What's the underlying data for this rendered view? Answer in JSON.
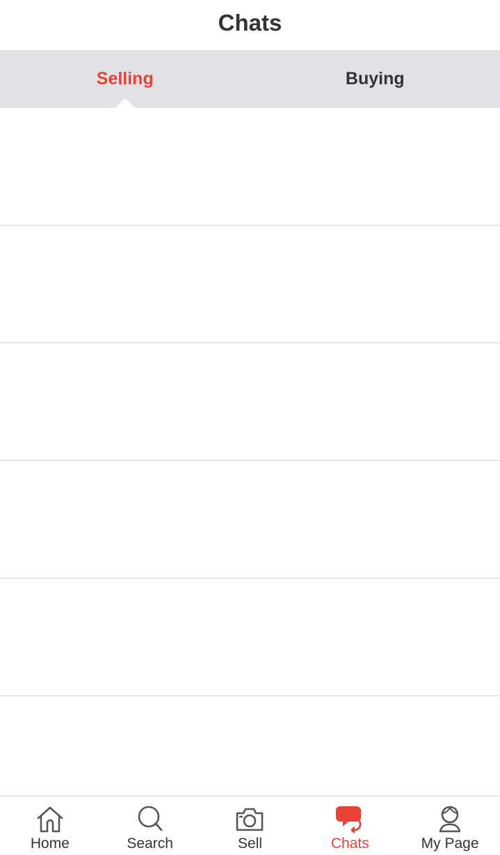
{
  "header": {
    "title": "Chats"
  },
  "tabs": [
    {
      "label": "Selling",
      "active": true
    },
    {
      "label": "Buying",
      "active": false
    }
  ],
  "list": {
    "rows": 6
  },
  "bottom_nav": {
    "items": [
      {
        "label": "Home",
        "icon": "home-icon",
        "active": false
      },
      {
        "label": "Search",
        "icon": "search-icon",
        "active": false
      },
      {
        "label": "Sell",
        "icon": "camera-icon",
        "active": false
      },
      {
        "label": "Chats",
        "icon": "chat-bubbles-icon",
        "active": true
      },
      {
        "label": "My Page",
        "icon": "person-icon",
        "active": false
      }
    ]
  },
  "colors": {
    "accent": "#e84237",
    "text": "#333333",
    "tabbar_bg": "#e2e2e6",
    "divider": "#d6d6d6",
    "icon_gray": "#555555"
  }
}
